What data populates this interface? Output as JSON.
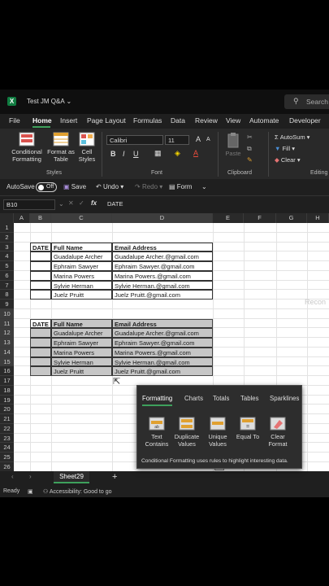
{
  "titlebar": {
    "app_icon": "X",
    "doc_title": "Test JM Q&A",
    "search": "Search"
  },
  "menu": [
    "File",
    "Home",
    "Insert",
    "Page Layout",
    "Formulas",
    "Data",
    "Review",
    "View",
    "Automate",
    "Developer"
  ],
  "ribbon": {
    "styles": {
      "conditional": "Conditional\nFormatting",
      "format_table": "Format as\nTable",
      "cell_styles": "Cell\nStyles",
      "group": "Styles"
    },
    "font": {
      "name": "Calibri",
      "size": "11",
      "group": "Font"
    },
    "clipboard": {
      "paste": "Paste",
      "group": "Clipboard"
    },
    "editing": {
      "autosum": "AutoSum",
      "fill": "Fill",
      "clear": "Clear",
      "group": "Editing"
    }
  },
  "qat": {
    "autosave": "AutoSave",
    "toggle": "Off",
    "save": "Save",
    "undo": "Undo",
    "redo": "Redo",
    "form": "Form"
  },
  "formula_bar": {
    "name_box": "B10",
    "fx": "fx",
    "content": "DATE"
  },
  "columns": [
    "A",
    "B",
    "C",
    "D",
    "E",
    "F",
    "G",
    "H"
  ],
  "rows": [
    "1",
    "2",
    "3",
    "4",
    "5",
    "6",
    "7",
    "8",
    "9",
    "10",
    "11",
    "12",
    "13",
    "14",
    "15",
    "16",
    "17",
    "18",
    "19",
    "20",
    "21",
    "22",
    "23",
    "24",
    "25",
    "26"
  ],
  "table_headers": {
    "date": "DATE",
    "name": "Full Name",
    "email": "Email Address"
  },
  "table1": [
    {
      "name": "Guadalupe Archer",
      "email": "Guadalupe Archer.@gmail.com"
    },
    {
      "name": "Ephraim Sawyer",
      "email": "Ephraim Sawyer.@gmail.com"
    },
    {
      "name": "Marina Powers",
      "email": "Marina Powers.@gmail.com"
    },
    {
      "name": "Sylvie Herman",
      "email": "Sylvie Herman.@gmail.com"
    },
    {
      "name": "Juelz Pruitt",
      "email": "Juelz Pruitt.@gmail.com"
    }
  ],
  "table2": [
    {
      "name": "Guadalupe Archer",
      "email": "Guadalupe Archer.@gmail.com"
    },
    {
      "name": "Ephraim Sawyer",
      "email": "Ephraim Sawyer.@gmail.com"
    },
    {
      "name": "Marina Powers",
      "email": "Marina Powers.@gmail.com"
    },
    {
      "name": "Sylvie Herman",
      "email": "Sylvie Herman.@gmail.com"
    },
    {
      "name": "Juelz Pruitt",
      "email": "Juelz Pruitt.@gmail.com"
    }
  ],
  "ghost_text": "Recon",
  "quick_analysis": {
    "tabs": [
      "Formatting",
      "Charts",
      "Totals",
      "Tables",
      "Sparklines"
    ],
    "buttons": [
      "Text\nContains",
      "Duplicate\nValues",
      "Unique\nValues",
      "Equal To",
      "Clear\nFormat"
    ],
    "description": "Conditional Formatting uses rules to highlight interesting data."
  },
  "sheet": {
    "name": "Sheet29",
    "add": "+"
  },
  "status": {
    "ready": "Ready",
    "accessibility": "Accessibility: Good to go"
  },
  "colors": {
    "accent": "#3ea05c",
    "selection": "#c6c6c6",
    "excel_green": "#107c41"
  }
}
